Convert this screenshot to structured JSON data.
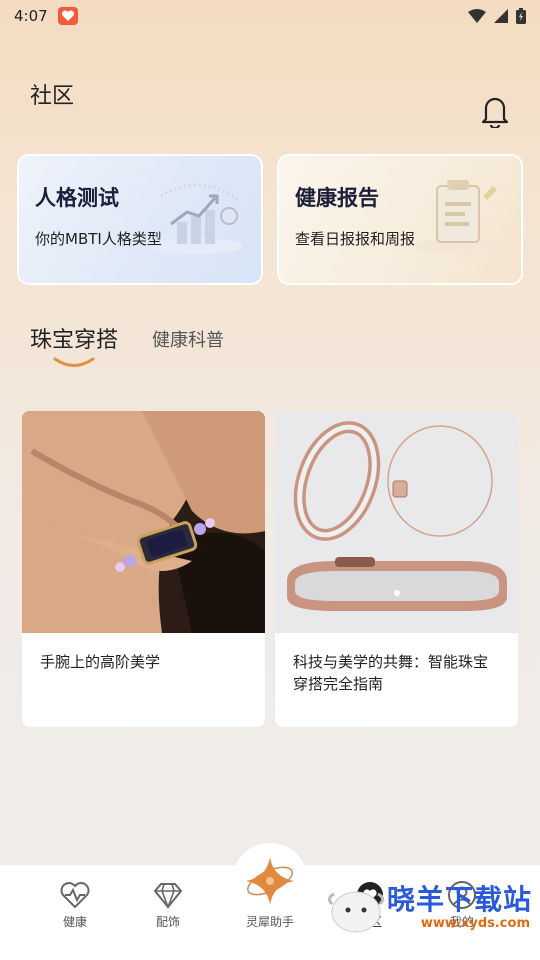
{
  "status_bar": {
    "time": "4:07"
  },
  "header": {
    "title": "社区"
  },
  "cards": [
    {
      "title": "人格测试",
      "subtitle": "你的MBTI人格类型"
    },
    {
      "title": "健康报告",
      "subtitle": "查看日报报和周报"
    }
  ],
  "tabs": [
    {
      "label": "珠宝穿搭",
      "active": true
    },
    {
      "label": "健康科普",
      "active": false
    }
  ],
  "posts": [
    {
      "title": "手腕上的高阶美学"
    },
    {
      "title": "科技与美学的共舞：智能珠宝穿搭完全指南"
    }
  ],
  "bottom_nav": [
    {
      "label": "健康",
      "icon": "heart-pulse-icon"
    },
    {
      "label": "配饰",
      "icon": "diamond-icon"
    },
    {
      "label": "灵犀助手",
      "icon": "sparkle-orbit-icon"
    },
    {
      "label": "社区",
      "icon": "community-heart-icon"
    },
    {
      "label": "我的",
      "icon": "user-icon"
    }
  ],
  "watermark": {
    "text": "晓羊下载站",
    "url": "www.xyds.com"
  },
  "colors": {
    "accent": "#e0913f",
    "brand_dark": "#1b1f3a"
  }
}
